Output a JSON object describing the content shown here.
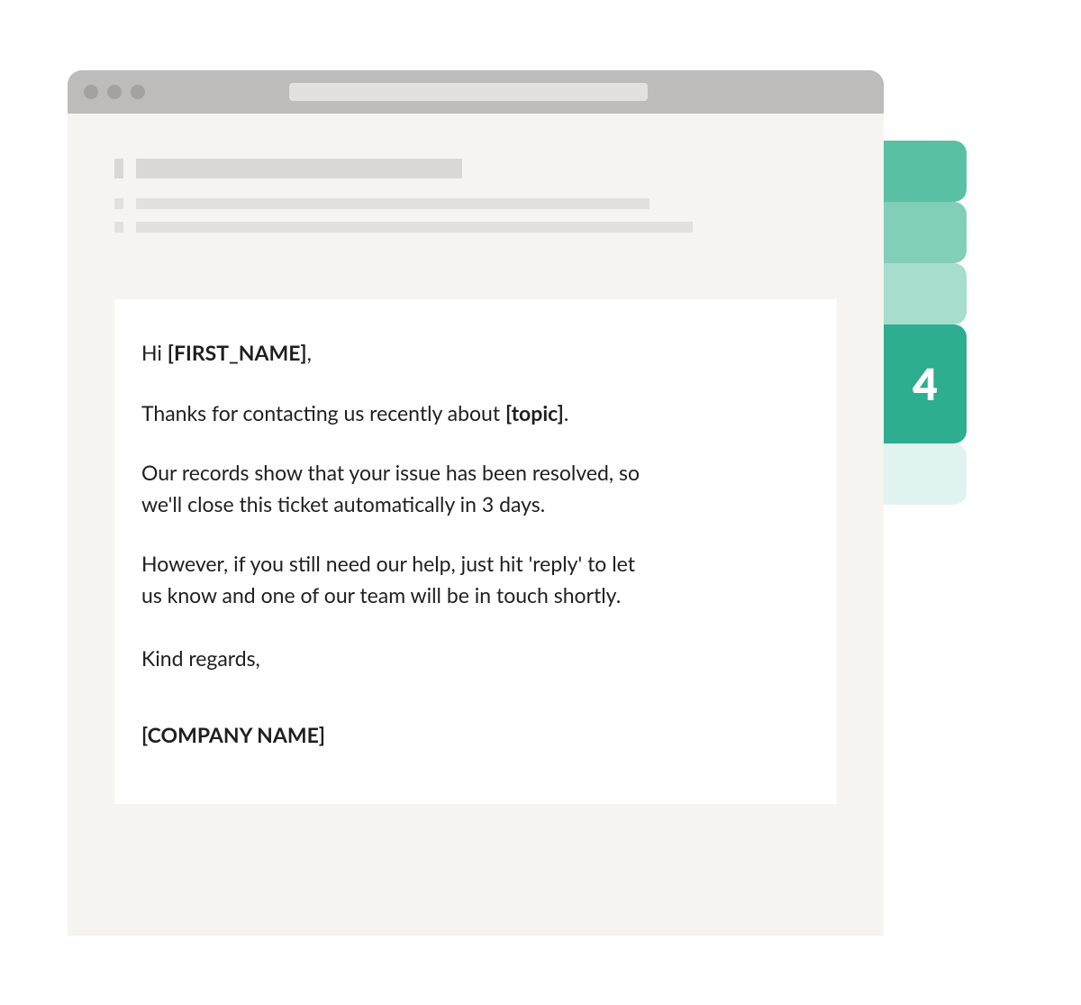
{
  "side_tabs": {
    "active_index": 3,
    "active_label": "4"
  },
  "message": {
    "greeting_prefix": "Hi ",
    "greeting_token": "[FIRST_NAME]",
    "greeting_suffix": ",",
    "thanks_prefix": "Thanks for contacting us recently about ",
    "thanks_token": "[topic]",
    "thanks_suffix": ".",
    "resolved": "Our records show that your issue has been resolved, so we'll close this ticket automatically in 3 days.",
    "however": "However, if you still need our help, just hit 'reply' to let us know and one of our team will be in touch shortly.",
    "signoff": "Kind regards,",
    "company_token": "[COMPANY NAME]"
  }
}
